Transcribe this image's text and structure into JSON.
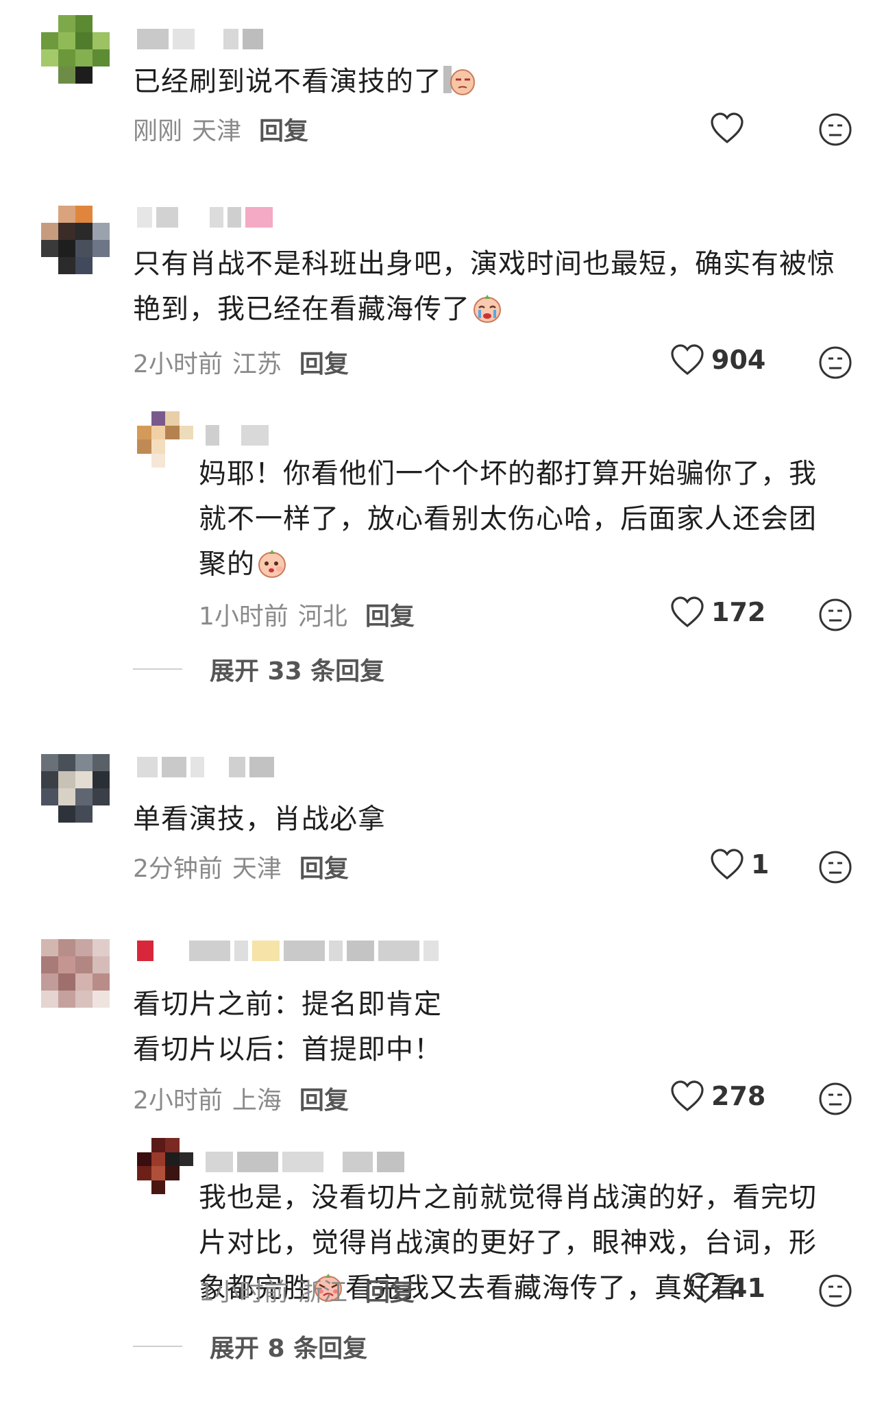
{
  "comments": [
    {
      "text": "已经刷到说不看演技的了",
      "emoji": "smirk-emoji",
      "time": "刚刚",
      "location": "天津",
      "reply": "回复",
      "likes": ""
    },
    {
      "text": "只有肖战不是科班出身吧，演戏时间也最短，确实有被惊艳到，我已经在看藏海传了",
      "emoji": "crying-emoji",
      "time": "2小时前",
      "location": "江苏",
      "reply": "回复",
      "likes": "904",
      "replies": [
        {
          "text": "妈耶！你看他们一个个坏的都打算开始骗你了，我就不一样了，放心看别太伤心哈，后面家人还会团聚的",
          "emoji": "shy-emoji",
          "time": "1小时前",
          "location": "河北",
          "reply": "回复",
          "likes": "172"
        }
      ],
      "expand": "展开 33 条回复"
    },
    {
      "text": "单看演技，肖战必拿",
      "time": "2分钟前",
      "location": "天津",
      "reply": "回复",
      "likes": "1"
    },
    {
      "text_line1": "看切片之前：提名即肯定",
      "text_line2": "看切片以后：首提即中！",
      "time": "2小时前",
      "location": "上海",
      "reply": "回复",
      "likes": "278",
      "replies": [
        {
          "text_before": "我也是，没看切片之前就觉得肖战演的好，看完切片对比，觉得肖战演的更好了，眼神戏，台词，形象都完胜",
          "emoji": "flushed-emoji",
          "text_after": "看完我又去看藏海传了，真好看",
          "time": "1小时前",
          "location": "浙江",
          "reply": "回复",
          "likes": "41"
        }
      ],
      "expand": "展开 8 条回复"
    }
  ],
  "colors": {
    "text": "#1e1e1e",
    "meta": "#8a8a8a",
    "reply": "#555555",
    "icon": "#333333"
  }
}
